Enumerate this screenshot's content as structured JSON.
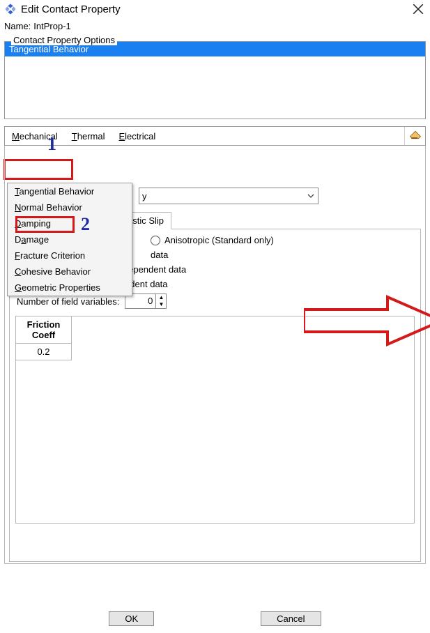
{
  "titlebar": {
    "title": "Edit Contact Property"
  },
  "name_row": {
    "label": "Name:",
    "value": "IntProp-1"
  },
  "options_box": {
    "legend": "Contact Property Options",
    "selected": "Tangential Behavior"
  },
  "menubar": {
    "mechanical": "Mechanical",
    "thermal": "Thermal",
    "electrical": "Electrical"
  },
  "dropdown": {
    "items": [
      "Tangential Behavior",
      "Normal Behavior",
      "Damping",
      "Damage",
      "Fracture Criterion",
      "Cohesive Behavior",
      "Geometric Properties"
    ]
  },
  "combo": {
    "suffix": "y"
  },
  "slip_tab": {
    "suffix": "astic Slip"
  },
  "friction": {
    "anisotropic_label": "Anisotropic (Standard only)",
    "data_suffix": "data",
    "check_pressure": "Use contact-pressure-dependent data",
    "check_temp": "Use temperature-dependent data",
    "nfv_label": "Number of field variables:",
    "nfv_value": "0",
    "coeff_head1": "Friction",
    "coeff_head2": "Coeff",
    "coeff_value": "0.2"
  },
  "buttons": {
    "ok": "OK",
    "cancel": "Cancel"
  },
  "annotations": {
    "one": "1",
    "two": "2"
  },
  "icons": {
    "app": "app-icon",
    "close": "close-icon",
    "eraser": "eraser-icon",
    "chevron": "chevron-down-icon"
  }
}
